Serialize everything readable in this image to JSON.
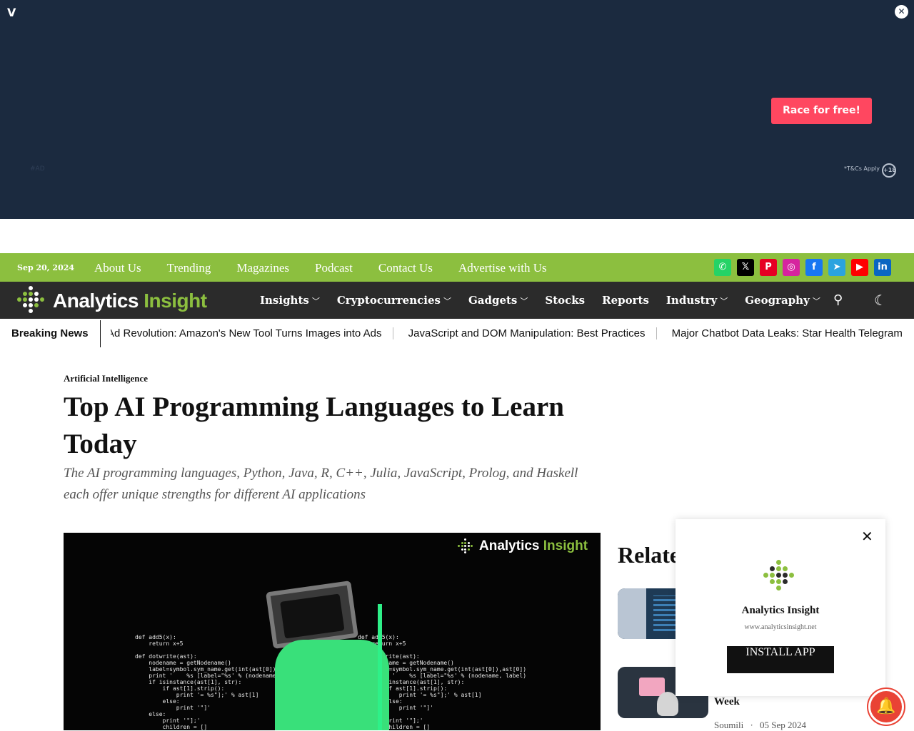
{
  "ad": {
    "logo": "V",
    "cta": "Race for free!",
    "terms": "*T&Cs Apply",
    "age": "+18",
    "tag": "#AD"
  },
  "topbar": {
    "date": "Sep 20, 2024",
    "links": [
      "About Us",
      "Trending",
      "Magazines",
      "Podcast",
      "Contact Us",
      "Advertise with Us"
    ],
    "social": [
      {
        "name": "whatsapp-icon",
        "glyph": "✆",
        "color": "#25d366"
      },
      {
        "name": "x-icon",
        "glyph": "𝕏",
        "color": "#000000"
      },
      {
        "name": "pinterest-icon",
        "glyph": "P",
        "color": "#e60023"
      },
      {
        "name": "instagram-icon",
        "glyph": "◎",
        "color": "#d6249f"
      },
      {
        "name": "facebook-icon",
        "glyph": "f",
        "color": "#1877f2"
      },
      {
        "name": "telegram-icon",
        "glyph": "➤",
        "color": "#2aa3df"
      },
      {
        "name": "youtube-icon",
        "glyph": "▶",
        "color": "#ff0000"
      },
      {
        "name": "linkedin-icon",
        "glyph": "in",
        "color": "#0a66c2"
      }
    ]
  },
  "nav": {
    "brand_main": "Analytics",
    "brand_accent": "Insight",
    "menu": [
      {
        "label": "Insights",
        "dropdown": true
      },
      {
        "label": "Cryptocurrencies",
        "dropdown": true
      },
      {
        "label": "Gadgets",
        "dropdown": true
      },
      {
        "label": "Stocks",
        "dropdown": false
      },
      {
        "label": "Reports",
        "dropdown": false
      },
      {
        "label": "Industry",
        "dropdown": true
      },
      {
        "label": "Geography",
        "dropdown": true
      }
    ]
  },
  "breaking": {
    "label": "Breaking News",
    "items": [
      "Ad Revolution: Amazon's New Tool Turns Images into Ads",
      "JavaScript and DOM Manipulation: Best Practices",
      "Major Chatbot Data Leaks: Star Health Telegram"
    ]
  },
  "article": {
    "category": "Artificial Intelligence",
    "title": "Top AI Programming Languages to Learn Today",
    "subtitle": "The AI programming languages, Python, Java, R, C++, Julia, JavaScript, Prolog, and Haskell each offer unique strengths for different AI applications",
    "hero_logo_main": "Analytics",
    "hero_logo_accent": "Insight",
    "hero_code": "def add5(x):\n    return x+5\n\ndef dotwrite(ast):\n    nodename = getNodename()\n    label=symbol.sym_name.get(int(ast[0]),ast[0])\n    print '    %s [label=\"%s' % (nodename, label)\n    if isinstance(ast[1], str):\n        if ast[1].strip():\n            print '= %s\"];' % ast[1]\n        else:\n            print '\"]'\n    else:\n        print '\"];'\n        children = []"
  },
  "related": {
    "heading": "Related",
    "item2_title": "Week",
    "item2_author": "Soumili",
    "item2_date": "05 Sep 2024"
  },
  "popup": {
    "name": "Analytics Insight",
    "url": "www.analyticsinsight.net",
    "button": "INSTALL APP"
  },
  "colors": {
    "brand_green": "#8cbf3f",
    "nav_bg": "#2b2b2b",
    "ad_bg": "#1b2a3f",
    "ad_cta": "#ff4760",
    "bell": "#e94335"
  }
}
